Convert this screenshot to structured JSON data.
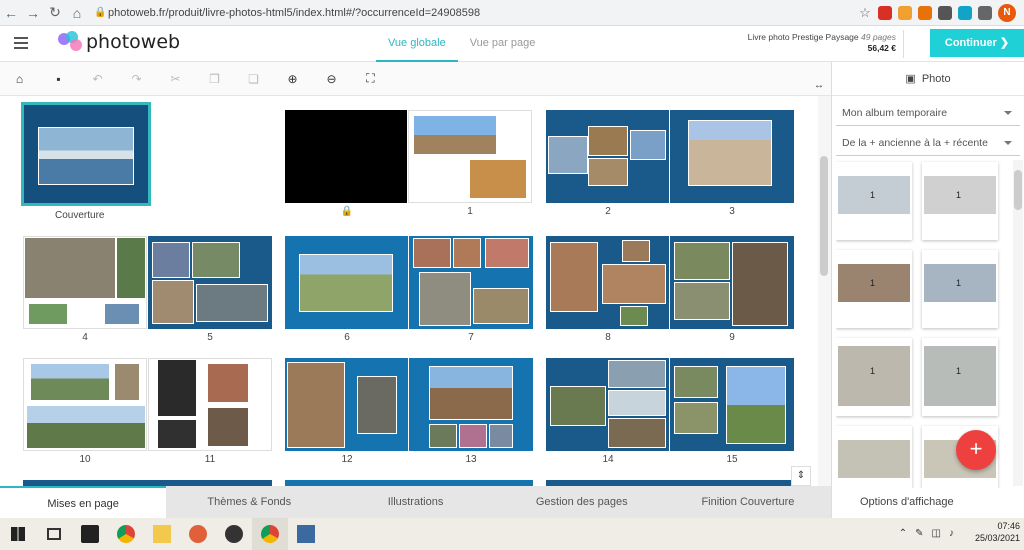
{
  "browser": {
    "url": "photoweb.fr/produit/livre-photos-html5/index.html#/?occurrenceId=24908598",
    "profile_letter": "N"
  },
  "app": {
    "logo": "photoweb",
    "views": [
      "Vue globale",
      "Vue par page"
    ],
    "product_name": "Livre photo Prestige Paysage",
    "product_pages": "49 pages",
    "product_price": "56,42 €",
    "continue_label": "Continuer ❯"
  },
  "toolbar": {
    "icons": [
      "home-icon",
      "save-icon",
      "undo-icon",
      "redo-icon",
      "cut-icon",
      "copy-icon",
      "paste-icon",
      "zoom-in-icon",
      "zoom-out-icon",
      "fit-screen-icon"
    ]
  },
  "pages": {
    "cover_label": "Couverture",
    "labels": [
      "1",
      "2",
      "3",
      "4",
      "5",
      "6",
      "7",
      "8",
      "9",
      "10",
      "11",
      "12",
      "13",
      "14",
      "15"
    ]
  },
  "right_panel": {
    "title": "Photo",
    "album_select": "Mon album temporaire",
    "sort_select": "De la + ancienne à la + récente",
    "thumb_badge": "1",
    "options_label": "Options d'affichage"
  },
  "bottom_tabs": [
    "Mises en page",
    "Thèmes & Fonds",
    "Illustrations",
    "Gestion des pages",
    "Finition Couverture"
  ],
  "taskbar": {
    "time": "07:46",
    "date": "25/03/2021"
  }
}
